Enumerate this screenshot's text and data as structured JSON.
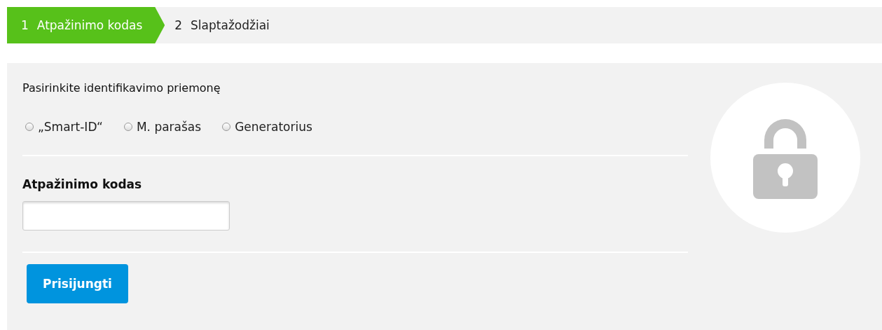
{
  "steps": [
    {
      "number": "1",
      "label": "Atpažinimo kodas",
      "selected": true
    },
    {
      "number": "2",
      "label": "Slaptažodžiai",
      "selected": false
    }
  ],
  "method": {
    "title": "Pasirinkite identifikavimo priemonę",
    "options": [
      {
        "label": "„Smart-ID“",
        "selected": false
      },
      {
        "label": "M. parašas",
        "selected": false
      },
      {
        "label": "Generatorius",
        "selected": false
      }
    ]
  },
  "code_field": {
    "label": "Atpažinimo kodas"
  },
  "submit": {
    "label": "Prisijungti"
  }
}
